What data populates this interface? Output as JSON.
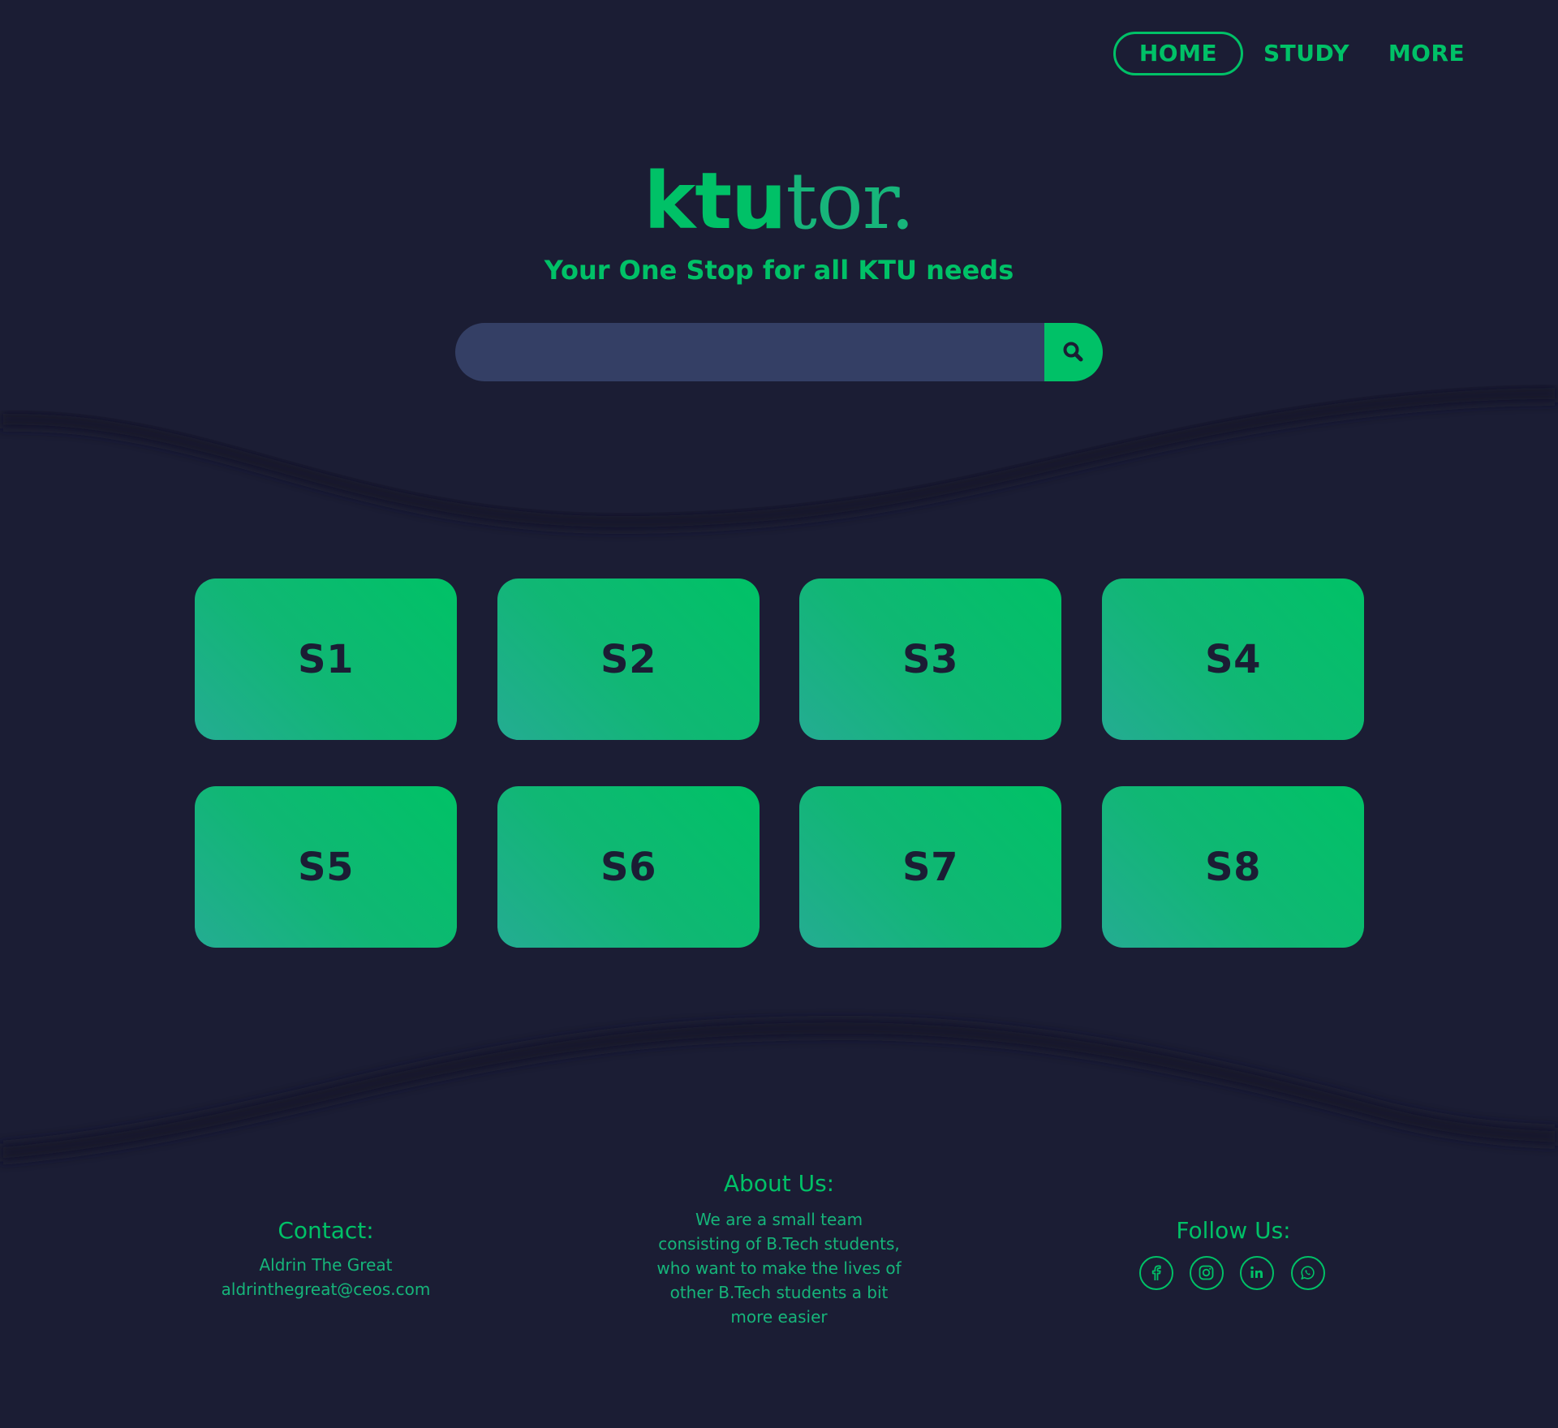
{
  "nav": {
    "items": [
      {
        "label": "HOME",
        "active": true
      },
      {
        "label": "STUDY",
        "active": false
      },
      {
        "label": "MORE",
        "active": false
      }
    ]
  },
  "hero": {
    "logo_bold": "ktu",
    "logo_light": "tor.",
    "tagline": "Your One Stop for all KTU needs"
  },
  "search": {
    "value": "",
    "placeholder": "",
    "button_icon": "search-icon"
  },
  "semesters": [
    "S1",
    "S2",
    "S3",
    "S4",
    "S5",
    "S6",
    "S7",
    "S8"
  ],
  "footer": {
    "contact": {
      "heading": "Contact:",
      "name": "Aldrin The Great",
      "email": "aldrinthegreat@ceos.com"
    },
    "about": {
      "heading": "About Us:",
      "text": "We are a small team consisting of B.Tech students, who want to make the lives of other B.Tech students a bit more easier"
    },
    "follow": {
      "heading": "Follow Us:",
      "icons": [
        "facebook-icon",
        "instagram-icon",
        "linkedin-icon",
        "whatsapp-icon"
      ]
    }
  },
  "colors": {
    "background": "#1b1d34",
    "accent": "#00c167",
    "search_field": "#343f65",
    "tile_gradient_start": "#24ac92",
    "tile_gradient_end": "#00c266"
  }
}
